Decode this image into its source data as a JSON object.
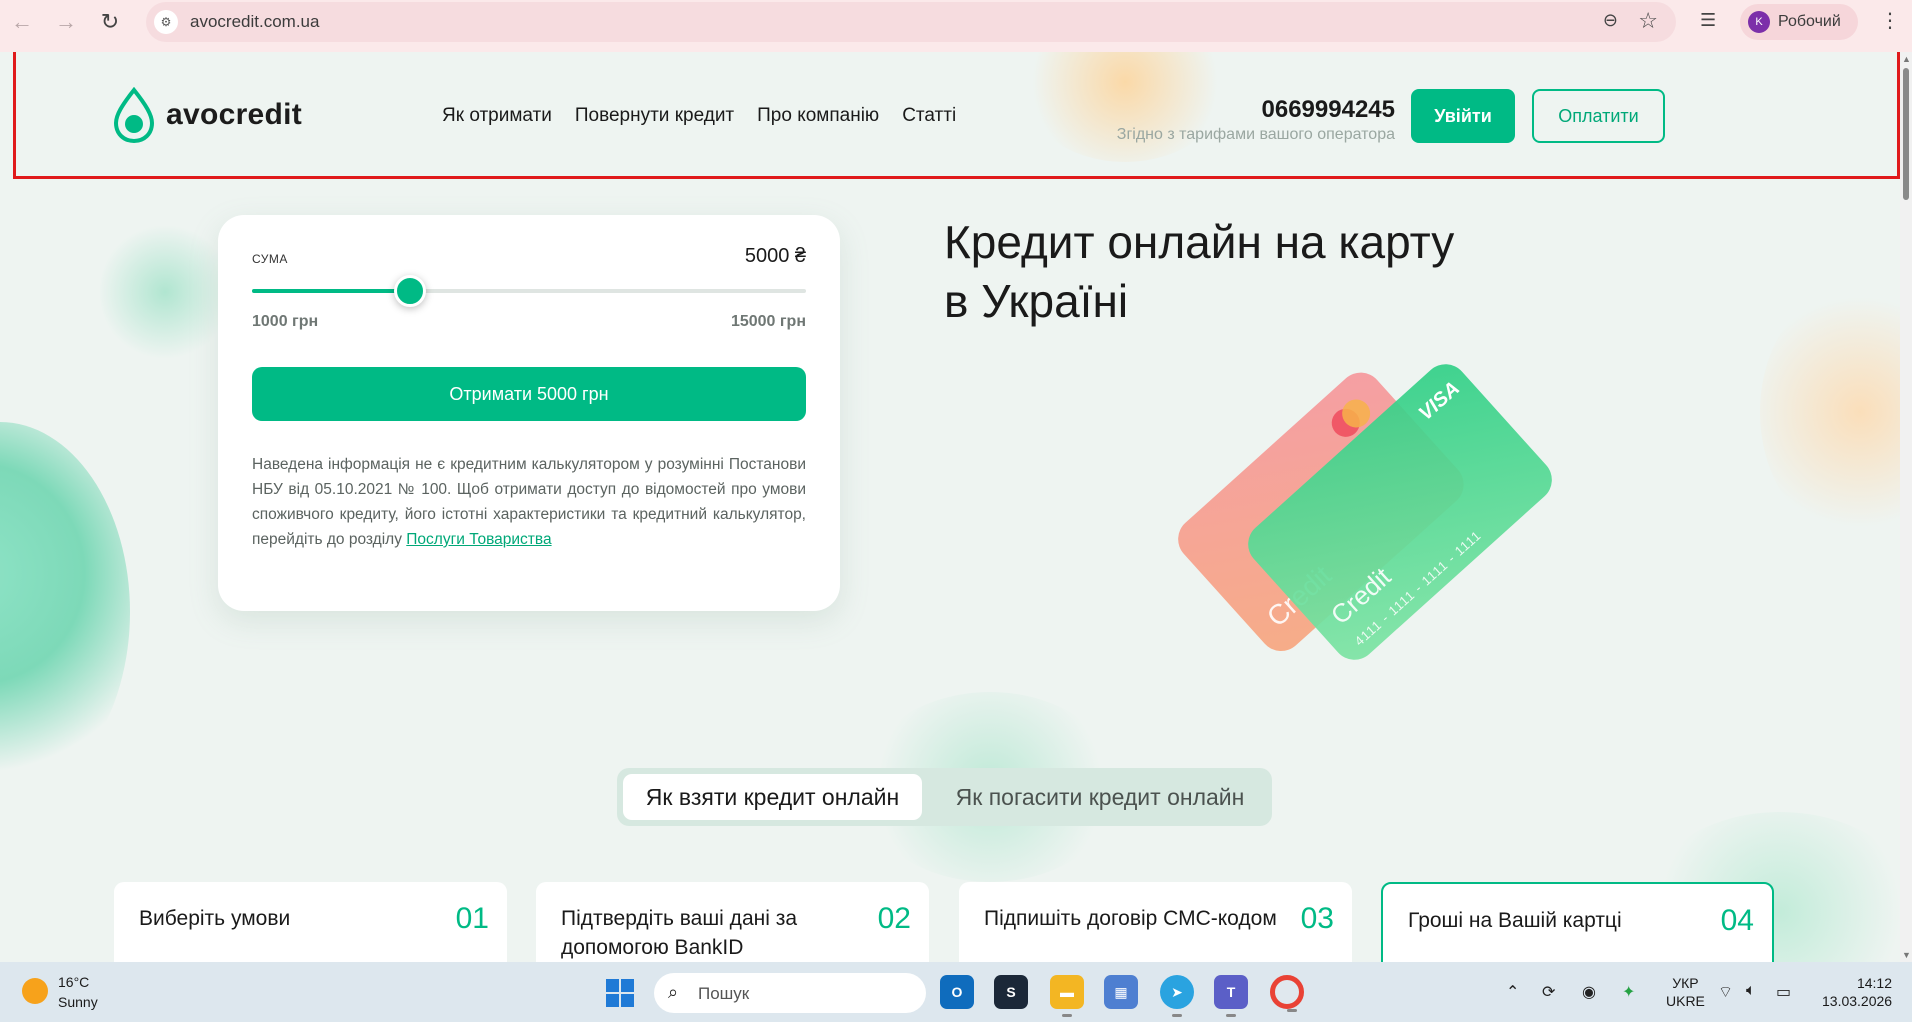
{
  "browser": {
    "url": "avocredit.com.ua",
    "profile_initial": "K",
    "profile_name": "Робочий"
  },
  "header": {
    "logo_text": "avocredit",
    "nav": [
      "Як отримати",
      "Повернути кредит",
      "Про компанію",
      "Статті"
    ],
    "phone": "0669994245",
    "phone_note": "Згідно з тарифами вашого оператора",
    "login_label": "Увійти",
    "pay_label": "Оплатити"
  },
  "calculator": {
    "label": "СУМА",
    "amount": "5000 ₴",
    "min_label": "1000 грн",
    "max_label": "15000 грн",
    "slider_min": 1000,
    "slider_max": 15000,
    "slider_value": 5000,
    "button_label": "Отримати 5000 грн",
    "note": "Наведена інформація не є кредитним калькулятором у розумінні Постанови НБУ від 05.10.2021 № 100. Щоб отримати доступ до відомостей про умови споживчого кредиту, його істотні характеристики та кредитний калькулятор, перейдіть до розділу",
    "note_link": "Послуги Товариства"
  },
  "hero": {
    "title": "Кредит онлайн на карту в Україні",
    "card1_text": "Credit",
    "card2_text": "Credit",
    "card2_brand": "VISA",
    "card2_number": "4111 - 1111 - 1111 - 1111"
  },
  "tabs": [
    "Як взяти кредит онлайн",
    "Як погасити кредит онлайн"
  ],
  "steps": [
    {
      "title": "Виберіть умови",
      "num": "01"
    },
    {
      "title": "Підтвердіть ваші дані за допомогою BankID",
      "num": "02"
    },
    {
      "title": "Підпишіть договір СМС-кодом",
      "num": "03"
    },
    {
      "title": "Гроші на Вашій картці",
      "num": "04"
    }
  ],
  "taskbar": {
    "weather_temp": "16°C",
    "weather_cond": "Sunny",
    "search_placeholder": "Пошук",
    "lang_line1": "УКР",
    "lang_line2": "UKRE",
    "time": "14:12",
    "date": "13.03.2026"
  },
  "colors": {
    "accent": "#00ba85",
    "highlight": "#e0191b"
  }
}
